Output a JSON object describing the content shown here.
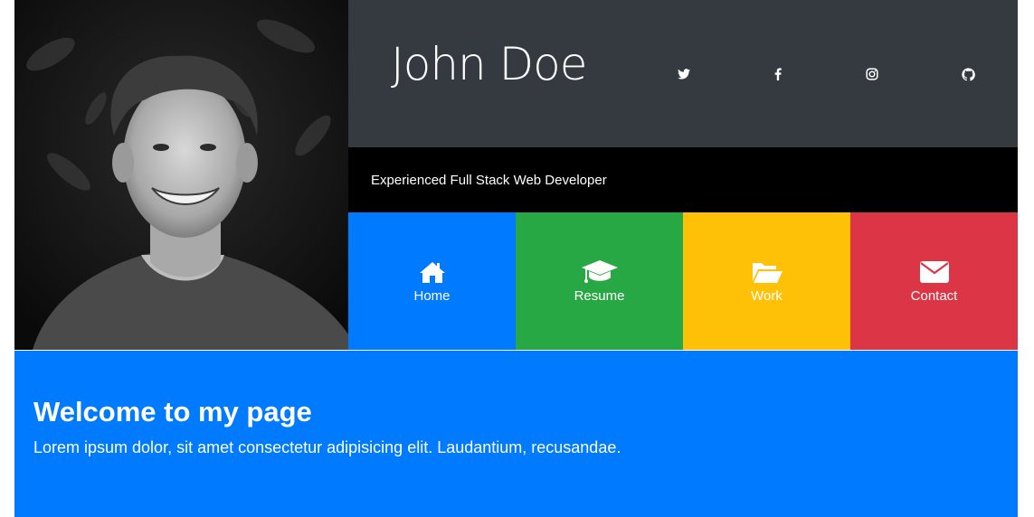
{
  "profile": {
    "name": "John Doe",
    "tagline": "Experienced Full Stack Web Developer",
    "photo_alt": "portrait photo"
  },
  "social": [
    {
      "name": "twitter-icon"
    },
    {
      "name": "facebook-icon"
    },
    {
      "name": "instagram-icon"
    },
    {
      "name": "github-icon"
    }
  ],
  "nav": [
    {
      "label": "Home",
      "icon": "home-icon",
      "color": "#007bff"
    },
    {
      "label": "Resume",
      "icon": "graduation-cap-icon",
      "color": "#28a745"
    },
    {
      "label": "Work",
      "icon": "folder-open-icon",
      "color": "#ffc107"
    },
    {
      "label": "Contact",
      "icon": "envelope-icon",
      "color": "#dc3545"
    }
  ],
  "welcome": {
    "heading": "Welcome to my page",
    "text": "Lorem ipsum dolor, sit amet consectetur adipisicing elit. Laudantium, recusandae."
  },
  "colors": {
    "header_bg": "#343a40",
    "tagline_bg": "#000000",
    "welcome_bg": "#007bff"
  }
}
